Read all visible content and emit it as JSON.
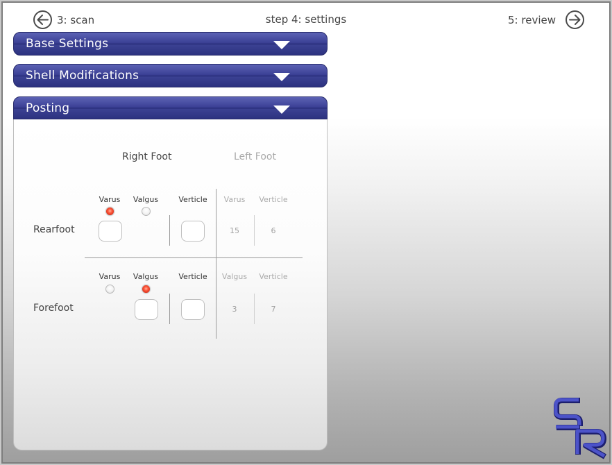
{
  "nav": {
    "prev_label": "3: scan",
    "title": "step 4: settings",
    "next_label": "5: review",
    "prev_icon": "arrow-left-circle-icon",
    "next_icon": "arrow-right-circle-icon"
  },
  "panels": {
    "base": "Base Settings",
    "shell": "Shell Modifications",
    "posting": "Posting"
  },
  "posting": {
    "right_foot": "Right Foot",
    "left_foot": "Left Foot",
    "rearfoot": {
      "label": "Rearfoot",
      "right": {
        "col1": "Varus",
        "col2": "Valgus",
        "col3": "Verticle",
        "selected": "Varus",
        "value": "",
        "verticle": ""
      },
      "left": {
        "col1": "Varus",
        "col2": "Verticle",
        "value1": "15",
        "value2": "6"
      }
    },
    "forefoot": {
      "label": "Forefoot",
      "right": {
        "col1": "Varus",
        "col2": "Valgus",
        "col3": "Verticle",
        "selected": "Valgus",
        "value": "",
        "verticle": ""
      },
      "left": {
        "col1": "Valgus",
        "col2": "Verticle",
        "value1": "3",
        "value2": "7"
      }
    }
  },
  "colors": {
    "panel_header": "#3c4196",
    "radio_selected": "#e23b22",
    "logo": "#3a3fa8"
  },
  "logo": {
    "text": "SR"
  }
}
